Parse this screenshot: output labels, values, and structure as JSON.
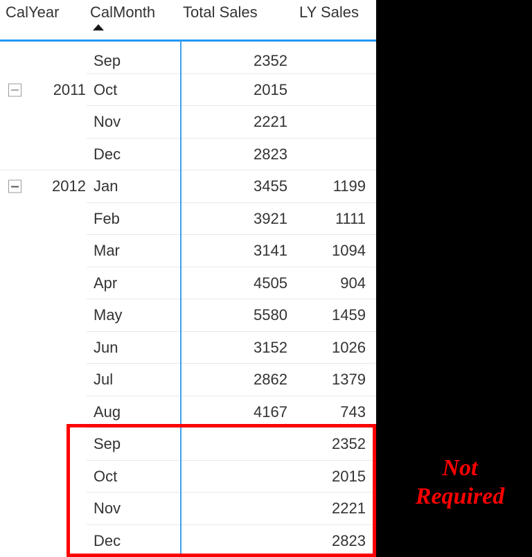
{
  "table": {
    "columns": [
      {
        "key": "calyear",
        "label": "CalYear",
        "align": "left"
      },
      {
        "key": "calmonth",
        "label": "CalMonth",
        "align": "left"
      },
      {
        "key": "total",
        "label": "Total Sales",
        "align": "right"
      },
      {
        "key": "ly",
        "label": "LY Sales",
        "align": "right"
      }
    ],
    "sort": {
      "column": "CalMonth",
      "direction": "ascending",
      "icon": "sort-ascending-triangle-icon"
    },
    "toggle_icon": "collapse-minus-icon",
    "rows": [
      {
        "year": "",
        "month": "Sep",
        "total": "2352",
        "ly": "",
        "group_start": false,
        "clipped": true,
        "highlighted": false,
        "group_end": false
      },
      {
        "year": "2011",
        "month": "Oct",
        "total": "2015",
        "ly": "",
        "group_start": true,
        "clipped": false,
        "highlighted": false,
        "group_end": false
      },
      {
        "year": "",
        "month": "Nov",
        "total": "2221",
        "ly": "",
        "group_start": false,
        "clipped": false,
        "highlighted": false,
        "group_end": false
      },
      {
        "year": "",
        "month": "Dec",
        "total": "2823",
        "ly": "",
        "group_start": false,
        "clipped": false,
        "highlighted": false,
        "group_end": true
      },
      {
        "year": "2012",
        "month": "Jan",
        "total": "3455",
        "ly": "1199",
        "group_start": true,
        "clipped": false,
        "highlighted": false,
        "group_end": false
      },
      {
        "year": "",
        "month": "Feb",
        "total": "3921",
        "ly": "1111",
        "group_start": false,
        "clipped": false,
        "highlighted": false,
        "group_end": false
      },
      {
        "year": "",
        "month": "Mar",
        "total": "3141",
        "ly": "1094",
        "group_start": false,
        "clipped": false,
        "highlighted": false,
        "group_end": false
      },
      {
        "year": "",
        "month": "Apr",
        "total": "4505",
        "ly": "904",
        "group_start": false,
        "clipped": false,
        "highlighted": false,
        "group_end": false
      },
      {
        "year": "",
        "month": "May",
        "total": "5580",
        "ly": "1459",
        "group_start": false,
        "clipped": false,
        "highlighted": false,
        "group_end": false
      },
      {
        "year": "",
        "month": "Jun",
        "total": "3152",
        "ly": "1026",
        "group_start": false,
        "clipped": false,
        "highlighted": false,
        "group_end": false
      },
      {
        "year": "",
        "month": "Jul",
        "total": "2862",
        "ly": "1379",
        "group_start": false,
        "clipped": false,
        "highlighted": false,
        "group_end": false
      },
      {
        "year": "",
        "month": "Aug",
        "total": "4167",
        "ly": "743",
        "group_start": false,
        "clipped": false,
        "highlighted": false,
        "group_end": false
      },
      {
        "year": "",
        "month": "Sep",
        "total": "",
        "ly": "2352",
        "group_start": false,
        "clipped": false,
        "highlighted": true,
        "group_end": false
      },
      {
        "year": "",
        "month": "Oct",
        "total": "",
        "ly": "2015",
        "group_start": false,
        "clipped": false,
        "highlighted": true,
        "group_end": false
      },
      {
        "year": "",
        "month": "Nov",
        "total": "",
        "ly": "2221",
        "group_start": false,
        "clipped": false,
        "highlighted": true,
        "group_end": false
      },
      {
        "year": "",
        "month": "Dec",
        "total": "",
        "ly": "2823",
        "group_start": false,
        "clipped": false,
        "highlighted": true,
        "group_end": false
      }
    ]
  },
  "annotation": {
    "label": "Not\nRequired",
    "color": "#fe0000",
    "box_color": "#fe0000"
  },
  "colors": {
    "header_underline": "#2196f3",
    "column_divider": "#3ca0ef",
    "text": "#333333",
    "row_separator": "#e8e8e8",
    "background": "#ffffff",
    "canvas": "#000000"
  }
}
